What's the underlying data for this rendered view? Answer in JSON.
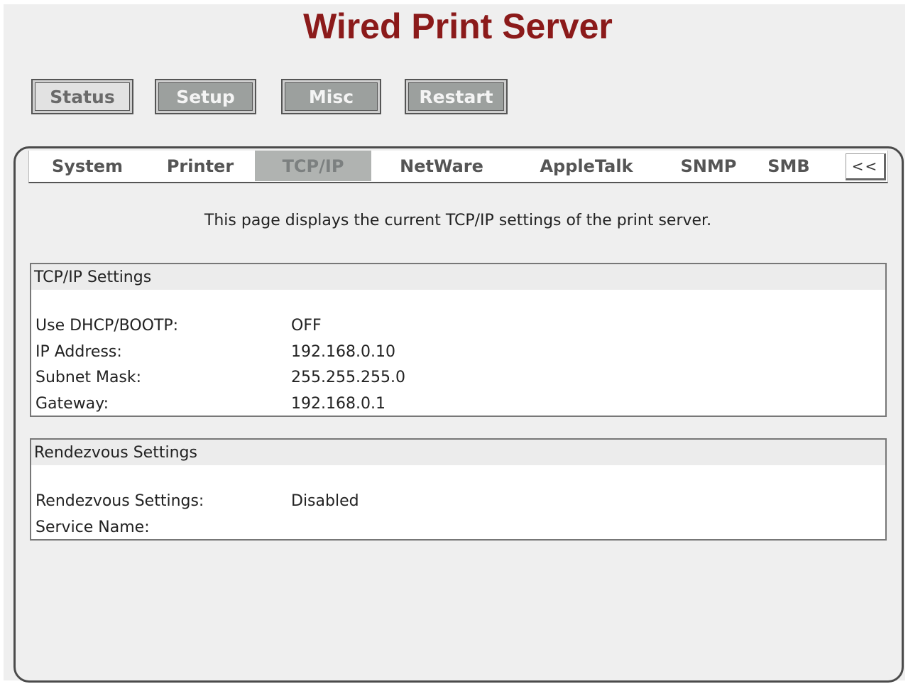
{
  "header": {
    "title": "Wired Print Server"
  },
  "top_nav": [
    {
      "label": "Status",
      "style": "normal"
    },
    {
      "label": "Setup",
      "style": "dark"
    },
    {
      "label": "Misc",
      "style": "dark"
    },
    {
      "label": "Restart",
      "style": "dark"
    }
  ],
  "sub_tabs": [
    {
      "label": "System",
      "active": false
    },
    {
      "label": "Printer",
      "active": false
    },
    {
      "label": "TCP/IP",
      "active": true
    },
    {
      "label": "NetWare",
      "active": false
    },
    {
      "label": "AppleTalk",
      "active": false
    },
    {
      "label": "SNMP",
      "active": false
    },
    {
      "label": "SMB",
      "active": false
    }
  ],
  "collapse_label": "<<",
  "description": "This page displays the current TCP/IP settings of the print server.",
  "tcpip_section": {
    "title": "TCP/IP Settings",
    "rows": [
      {
        "label": "Use DHCP/BOOTP:",
        "value": "OFF"
      },
      {
        "label": "IP Address:",
        "value": "192.168.0.10"
      },
      {
        "label": "Subnet Mask:",
        "value": "255.255.255.0"
      },
      {
        "label": "Gateway:",
        "value": "192.168.0.1"
      }
    ]
  },
  "rendezvous_section": {
    "title": "Rendezvous Settings",
    "rows": [
      {
        "label": "Rendezvous Settings:",
        "value": "Disabled"
      },
      {
        "label": "Service Name:",
        "value": ""
      }
    ]
  },
  "colors": {
    "title": "#8b1a1a",
    "active_tab": "#b0b3b1",
    "dark_button": "#9ca09e",
    "panel_border": "#4b4b4b"
  }
}
